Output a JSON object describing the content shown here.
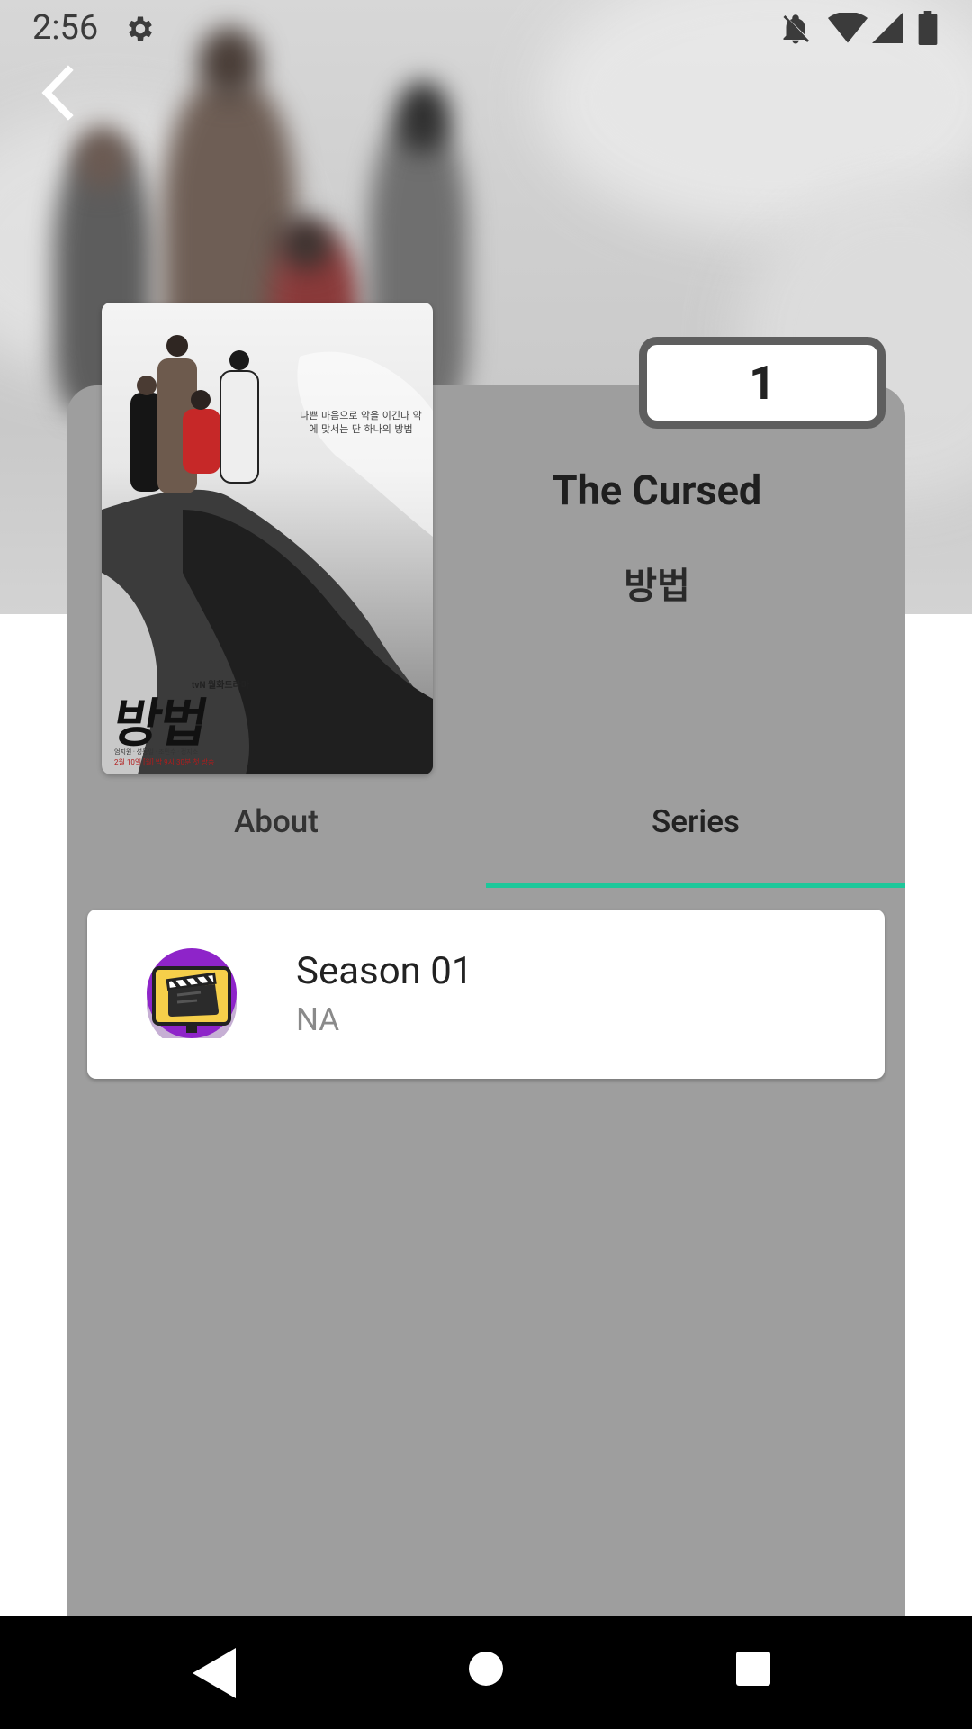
{
  "status_bar": {
    "time": "2:56",
    "icons": [
      "gear-icon",
      "bell-off-icon",
      "wifi-icon",
      "signal-icon",
      "battery-icon"
    ]
  },
  "header": {
    "back_icon": "chevron-left-icon"
  },
  "show": {
    "title": "The Cursed",
    "original_title": "방법",
    "rating_badge": "1",
    "poster": {
      "title_text": "방법",
      "tagline": "나쁜 마음으로 악을 이긴다 악에 맞서는 단 하나의 방법",
      "channel": "tvN 월화드라마",
      "credits": "엄지원 · 성동일 · 조민수 · 정지소",
      "air_date": "2월 10일 [월] 밤 9시 30분 첫 방송"
    }
  },
  "tabs": [
    {
      "label": "About",
      "selected": false
    },
    {
      "label": "Series",
      "selected": true
    }
  ],
  "seasons": [
    {
      "name": "Season 01",
      "subtitle": "NA",
      "icon": "clapperboard-icon"
    }
  ],
  "colors": {
    "card": "#9e9e9e",
    "tab_indicator": "#1dc79a",
    "badge_border": "#5e5e5e",
    "avatar_purple": "#8e24c9",
    "avatar_yellow": "#f6cf4a"
  },
  "nav_bar": {
    "icons": [
      "nav-back-icon",
      "nav-home-icon",
      "nav-recents-icon"
    ]
  }
}
